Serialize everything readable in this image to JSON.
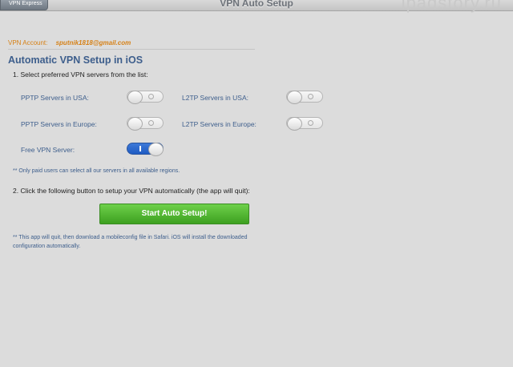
{
  "navbar": {
    "back_label": "VPN Express",
    "title": "VPN Auto Setup",
    "watermark": "ipadstory.ru"
  },
  "account": {
    "label": "VPN Account:",
    "email": "sputnik1818@gmail.com"
  },
  "section_title": "Automatic VPN Setup in iOS",
  "step1": "1. Select preferred VPN servers from the list:",
  "servers": {
    "pptp_usa": {
      "label": "PPTP Servers in USA:",
      "on": false
    },
    "l2tp_usa": {
      "label": "L2TP Servers in USA:",
      "on": false
    },
    "pptp_europe": {
      "label": "PPTP Servers in Europe:",
      "on": false
    },
    "l2tp_europe": {
      "label": "L2TP Servers in Europe:",
      "on": false
    },
    "free": {
      "label": "Free VPN Server:",
      "on": true
    }
  },
  "note1": "** Only paid users can select all our servers in all available regions.",
  "step2": "2. Click the following button to setup your VPN automatically (the app will quit):",
  "start_button": "Start Auto Setup!",
  "note2_line1": "** This app will quit, then download a mobileconfig file in Safari. iOS will install the downloaded",
  "note2_line2": "configuration automatically."
}
